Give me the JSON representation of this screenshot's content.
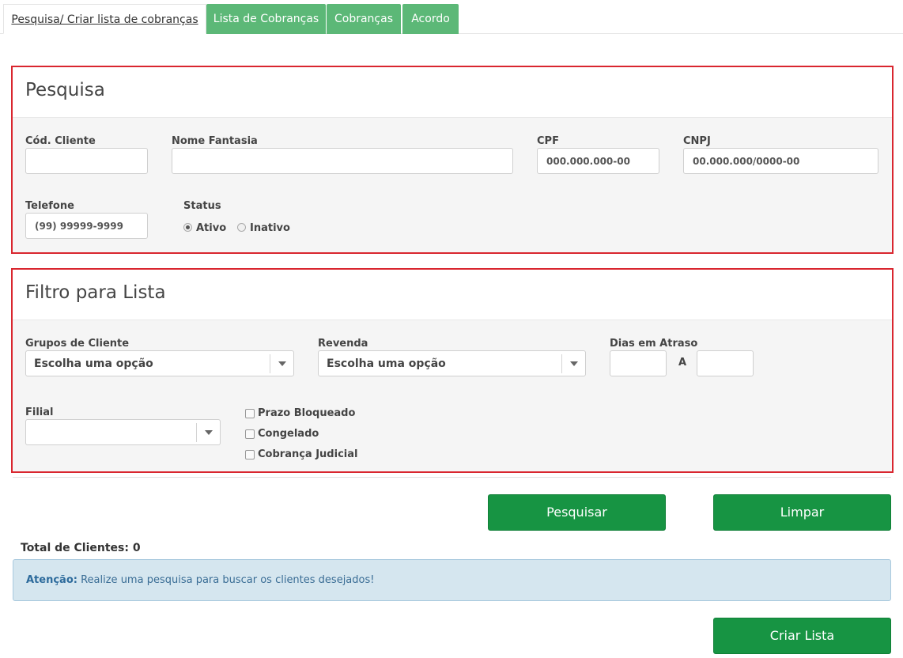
{
  "tabs": [
    {
      "label": "Pesquisa/ Criar lista de cobranças",
      "active": true
    },
    {
      "label": "Lista de Cobranças"
    },
    {
      "label": "Cobranças"
    },
    {
      "label": "Acordo"
    }
  ],
  "pesquisa": {
    "title": "Pesquisa",
    "cod_cliente_label": "Cód. Cliente",
    "nome_fantasia_label": "Nome Fantasia",
    "cpf_label": "CPF",
    "cpf_placeholder": "000.000.000-00",
    "cnpj_label": "CNPJ",
    "cnpj_placeholder": "00.000.000/0000-00",
    "telefone_label": "Telefone",
    "telefone_placeholder": "(99) 99999-9999",
    "status_label": "Status",
    "status_options": [
      "Ativo",
      "Inativo"
    ],
    "status_selected": "Ativo"
  },
  "filtro": {
    "title": "Filtro para Lista",
    "grupos_label": "Grupos de Cliente",
    "grupos_value": "Escolha uma opção",
    "revenda_label": "Revenda",
    "revenda_value": "Escolha uma opção",
    "dias_label": "Dias em Atraso",
    "dias_sep": "A",
    "filial_label": "Filial",
    "filial_value": "",
    "checkboxes": [
      "Prazo Bloqueado",
      "Congelado",
      "Cobrança Judicial"
    ]
  },
  "actions": {
    "pesquisar": "Pesquisar",
    "limpar": "Limpar",
    "criar_lista": "Criar Lista"
  },
  "total": "Total de Clientes: 0",
  "alert": {
    "strong": "Atenção:",
    "text": " Realize uma pesquisa para buscar os clientes desejados!"
  },
  "colors": {
    "tab_green": "#5cb877",
    "button_green": "#179443",
    "panel_border": "#d9262f",
    "alert_bg": "#d5e6ef"
  }
}
